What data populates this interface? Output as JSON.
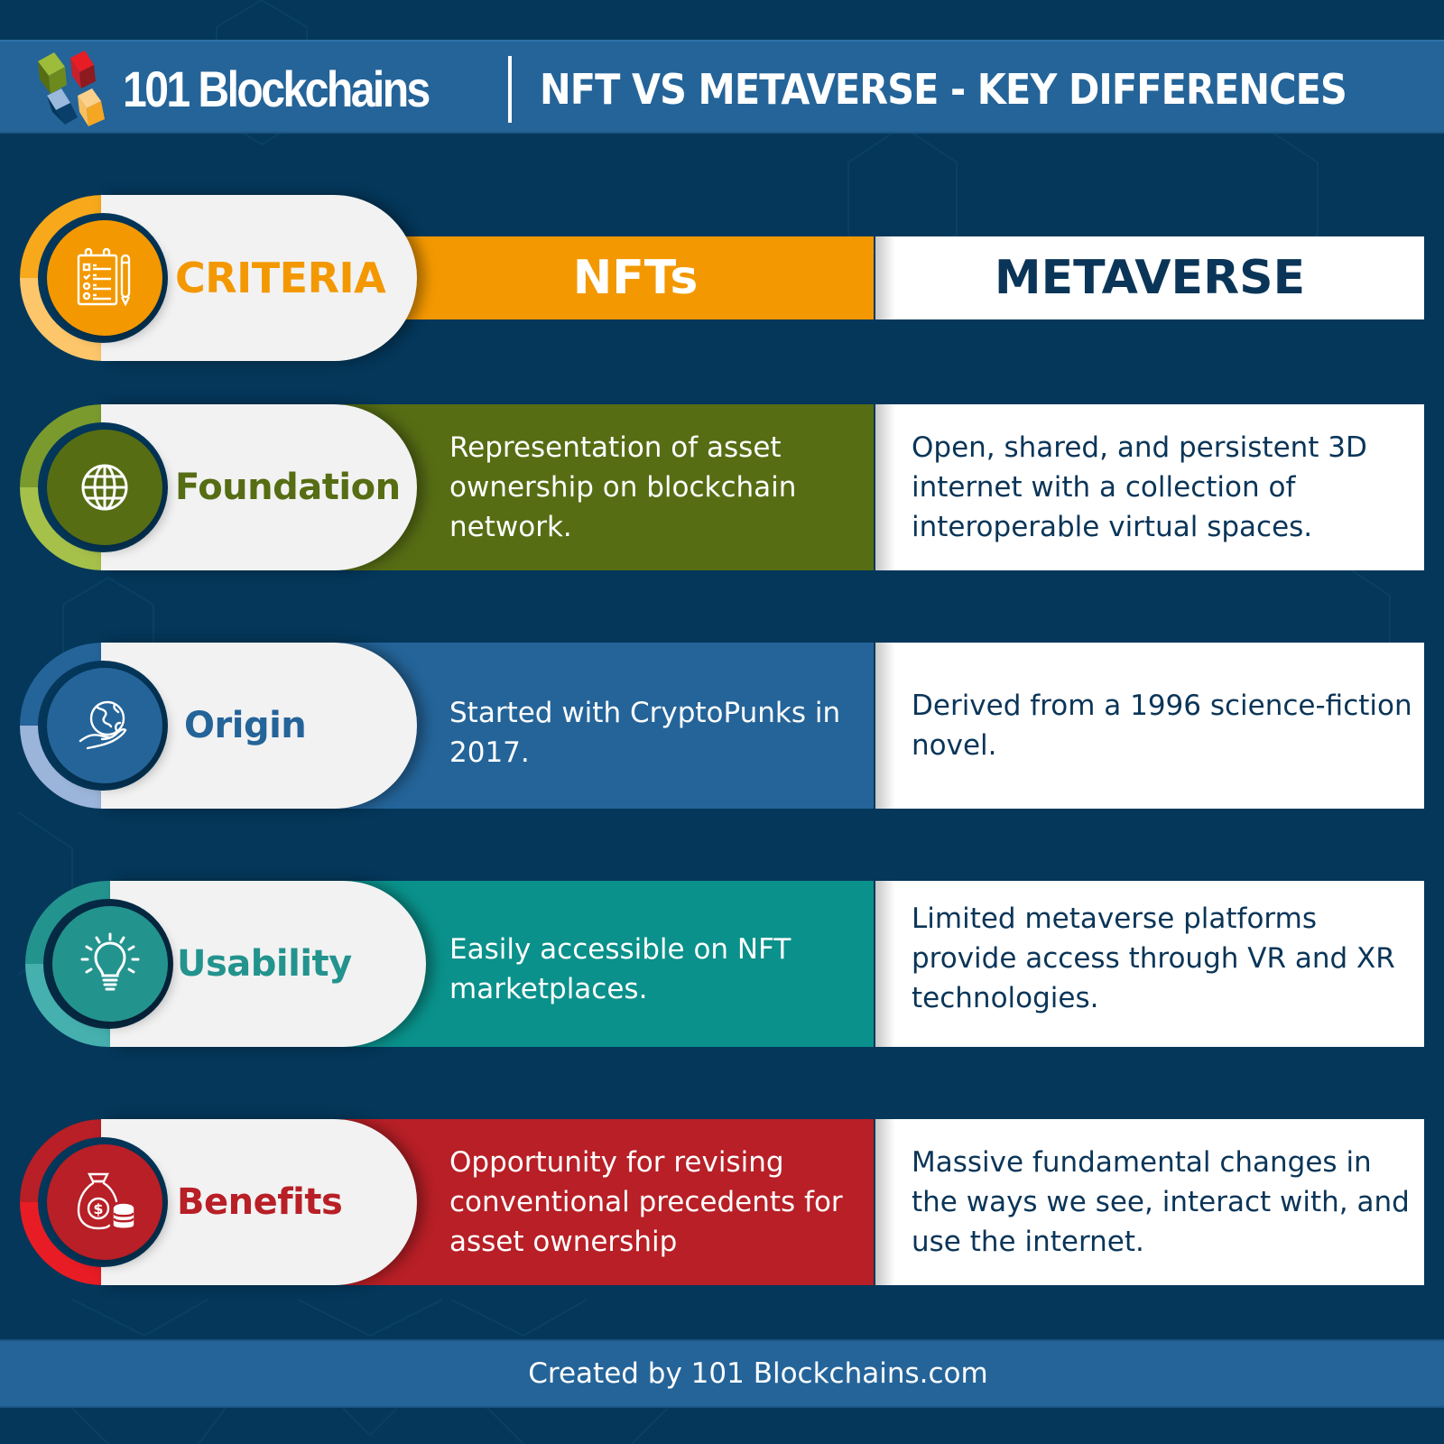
{
  "header": {
    "brand": "101 Blockchains",
    "title": "NFT VS METAVERSE - KEY DIFFERENCES",
    "logo_icon": "stacked-cubes-logo-icon",
    "logo_colors": [
      "#7a9a2e",
      "#c5202c",
      "#9bb8dd",
      "#f5a623"
    ]
  },
  "columns": {
    "criteria": "CRITERIA",
    "nft": "NFTs",
    "metaverse": "METAVERSE",
    "criteria_icon": "checklist-pencil-icon",
    "criteria_color": "#f39800"
  },
  "rows": [
    {
      "criterion": "Foundation",
      "icon": "globe-icon",
      "color": "#566d14",
      "ring_top": "#7a9a2e",
      "ring_bottom": "#a6c14a",
      "nft": "Representation of asset ownership on blockchain network.",
      "metaverse": "Open, shared, and persistent 3D internet with a collection of interoperable virtual spaces."
    },
    {
      "criterion": "Origin",
      "icon": "globe-in-hand-icon",
      "color": "#246499",
      "ring_top": "#246499",
      "ring_bottom": "#9bb4d9",
      "nft": "Started with CryptoPunks in 2017.",
      "metaverse": "Derived from a 1996 science-fiction novel."
    },
    {
      "criterion": "Usability",
      "icon": "lightbulb-icon",
      "color": "#0a918b",
      "label_color": "#23938e",
      "ring_top": "#23938e",
      "ring_bottom": "#46b0ae",
      "nft": "Easily accessible on NFT marketplaces.",
      "metaverse": "Limited metaverse platforms provide access through VR and XR technologies."
    },
    {
      "criterion": "Benefits",
      "icon": "money-bag-coins-icon",
      "color": "#b81f26",
      "ring_top": "#b81f26",
      "ring_bottom": "#e81c24",
      "nft": "Opportunity for revising conventional precedents for asset ownership",
      "metaverse": "Massive fundamental changes in the ways we see, interact with, and use the internet."
    }
  ],
  "footer": {
    "text": "Created by 101 Blockchains.com"
  }
}
